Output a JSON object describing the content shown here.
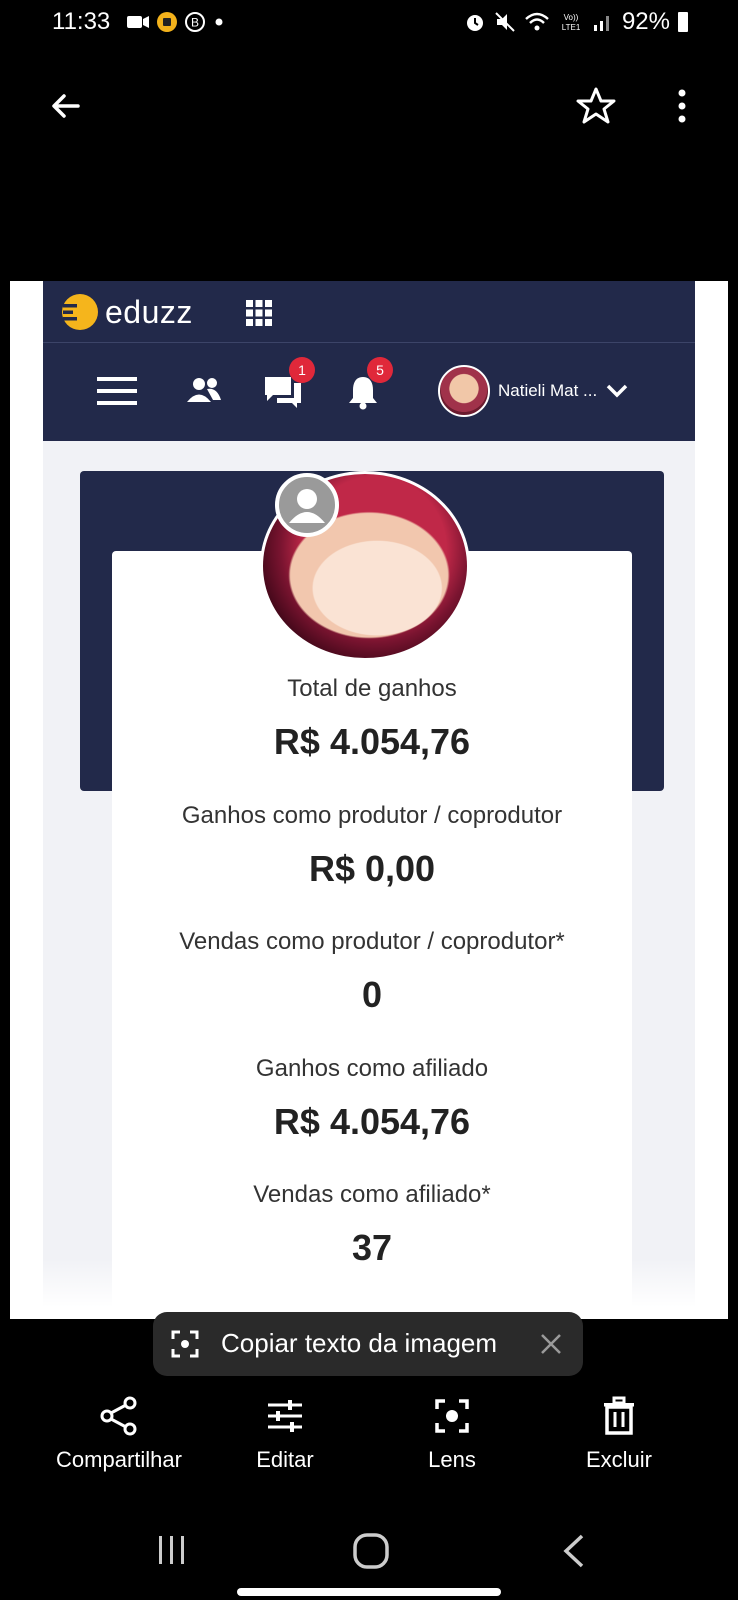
{
  "status_bar": {
    "time": "11:33",
    "battery": "92%",
    "icons": [
      "video-icon",
      "recording-icon",
      "b-icon",
      "dot-icon",
      "alarm-icon",
      "mute-icon",
      "wifi-icon",
      "volte-icon",
      "signal-icon",
      "battery-icon"
    ]
  },
  "viewer": {
    "back_icon": "arrow-left-icon",
    "favorite_icon": "star-icon",
    "menu_icon": "more-vertical-icon"
  },
  "app": {
    "logo_text": "eduzz",
    "user_name": "Natieli Mat ...",
    "messages_count": "1",
    "notifications_count": "5",
    "colors": {
      "navbar": "#22294a",
      "logo_accent": "#f5b51c",
      "badge": "#e0283a"
    }
  },
  "stats": [
    {
      "label": "Total de ganhos",
      "value": "R$ 4.054,76"
    },
    {
      "label": "Ganhos como produtor / coprodutor",
      "value": "R$ 0,00"
    },
    {
      "label": "Vendas como produtor / coprodutor*",
      "value": "0"
    },
    {
      "label": "Ganhos como afiliado",
      "value": "R$ 4.054,76"
    },
    {
      "label": "Vendas como afiliado*",
      "value": "37"
    }
  ],
  "chip": {
    "text": "Copiar texto da imagem"
  },
  "actions": {
    "share": "Compartilhar",
    "edit": "Editar",
    "lens": "Lens",
    "delete": "Excluir"
  }
}
